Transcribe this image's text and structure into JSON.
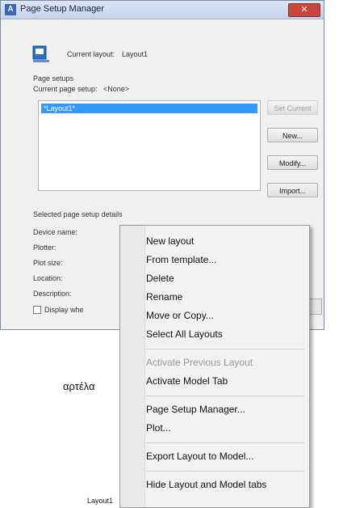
{
  "dialog": {
    "title": "Page Setup Manager",
    "close_label": "✕",
    "app_icon": "autocad-icon",
    "current_layout_label": "Current layout:",
    "current_layout_value": "Layout1",
    "page_setups_label": "Page setups",
    "current_page_setup_label": "Current page setup:",
    "current_page_setup_value": "<None>",
    "list_items": [
      "*Layout1*"
    ],
    "buttons": {
      "set_current": "Set Current",
      "new": "New...",
      "modify": "Modify...",
      "import": "Import..."
    },
    "details_label": "Selected page setup details",
    "details": {
      "device_name": "Device name:",
      "plotter": "Plotter:",
      "plot_size": "Plot size:",
      "location": "Location:",
      "description": "Description:"
    },
    "checkbox_label": "Display whe"
  },
  "context_menu": {
    "items": [
      "New layout",
      "From template...",
      "Delete",
      "Rename",
      "Move or Copy...",
      "Select All Layouts",
      "Activate Previous Layout",
      "Activate Model Tab",
      "Page Setup Manager...",
      "Plot...",
      "Export Layout to Model...",
      "Hide Layout and Model tabs"
    ]
  },
  "background_text": "αρτέλα",
  "layout_tab_label": "Layout1",
  "colors": {
    "selection": "#3399ff",
    "titlebar": "#c3d4ea",
    "close": "#c9463d"
  }
}
